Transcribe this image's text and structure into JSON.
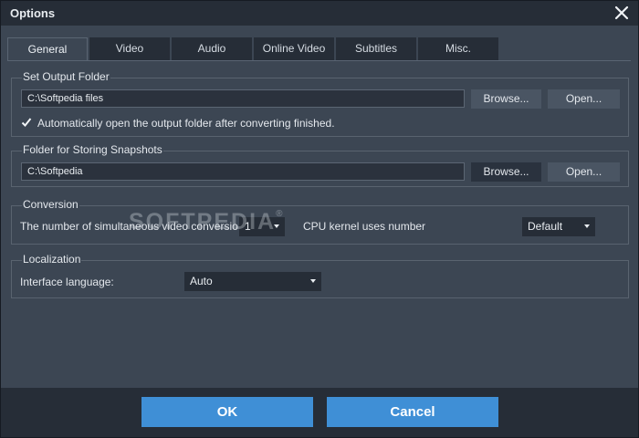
{
  "window": {
    "title": "Options"
  },
  "tabs": [
    {
      "label": "General",
      "active": true
    },
    {
      "label": "Video"
    },
    {
      "label": "Audio"
    },
    {
      "label": "Online Video"
    },
    {
      "label": "Subtitles"
    },
    {
      "label": "Misc."
    }
  ],
  "output_folder": {
    "label": "Set Output Folder",
    "path": "C:\\Softpedia files",
    "browse_label": "Browse...",
    "open_label": "Open...",
    "auto_open_checked": true,
    "auto_open_label": "Automatically open the output folder after converting finished."
  },
  "snapshots": {
    "label": "Folder for Storing Snapshots",
    "path": "C:\\Softpedia",
    "browse_label": "Browse...",
    "open_label": "Open..."
  },
  "conversion": {
    "label": "Conversion",
    "simultaneous_label": "The number of simultaneous video conversio",
    "simultaneous_value": "1",
    "cpu_label": "CPU kernel uses number",
    "cpu_value": "Default"
  },
  "localization": {
    "label": "Localization",
    "language_label": "Interface language:",
    "language_value": "Auto"
  },
  "watermark": {
    "text": "SOFTPEDIA",
    "mark": "®"
  },
  "footer": {
    "ok_label": "OK",
    "cancel_label": "Cancel"
  },
  "colors": {
    "accent": "#3f8fd6",
    "panel": "#3c4653",
    "dark": "#262d37"
  },
  "icons": {
    "close": "close-icon",
    "check": "checkmark-icon",
    "dropdown": "chevron-down-icon"
  }
}
